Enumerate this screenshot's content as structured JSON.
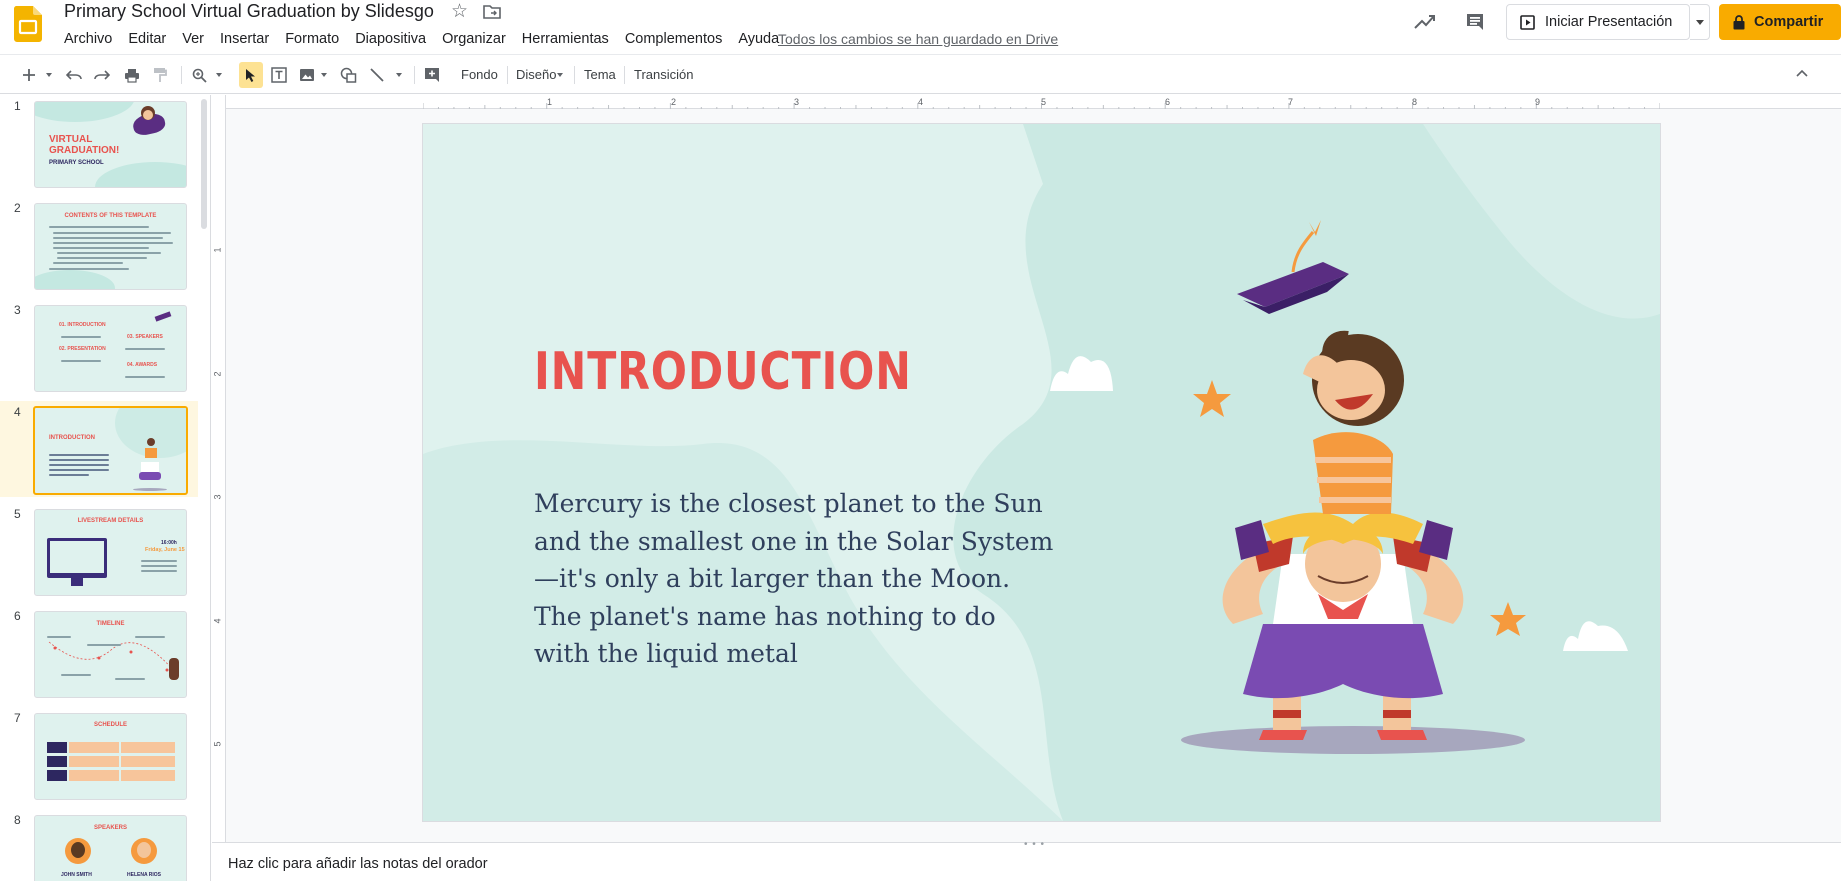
{
  "app": {
    "title": "Primary School Virtual Graduation by Slidesgo",
    "saved_status": "Todos los cambios se han guardado en Drive",
    "accent_color": "#f9ab00"
  },
  "menu": [
    "Archivo",
    "Editar",
    "Ver",
    "Insertar",
    "Formato",
    "Diapositiva",
    "Organizar",
    "Herramientas",
    "Complementos",
    "Ayuda"
  ],
  "header": {
    "present_label": "Iniciar Presentación",
    "share_label": "Compartir"
  },
  "toolbar": {
    "background_label": "Fondo",
    "layout_label": "Diseño",
    "theme_label": "Tema",
    "transition_label": "Transición"
  },
  "rulers": {
    "horizontal": [
      "1",
      "2",
      "3",
      "4",
      "5",
      "6",
      "7",
      "8",
      "9"
    ],
    "vertical": [
      "1",
      "2",
      "3",
      "4",
      "5"
    ]
  },
  "filmstrip": {
    "active_index": 4,
    "slides": [
      {
        "number": "1",
        "title": "VIRTUAL GRADUATION!",
        "subtitle": "PRIMARY SCHOOL"
      },
      {
        "number": "2",
        "title": "CONTENTS OF THIS TEMPLATE"
      },
      {
        "number": "3",
        "items": [
          "01. INTRODUCTION",
          "02. PRESENTATION",
          "03. SPEAKERS",
          "04. AWARDS"
        ]
      },
      {
        "number": "4",
        "title": "INTRODUCTION"
      },
      {
        "number": "5",
        "title": "LIVESTREAM DETAILS",
        "time": "16:00h",
        "date": "Friday, June 15"
      },
      {
        "number": "6",
        "title": "TIMELINE"
      },
      {
        "number": "7",
        "title": "SCHEDULE"
      },
      {
        "number": "8",
        "title": "SPEAKERS",
        "names": [
          "JOHN SMITH",
          "HELENA RIOS"
        ]
      }
    ]
  },
  "slide": {
    "title": "INTRODUCTION",
    "body": "Mercury is the closest planet to the Sun and the smallest one in the Solar System—it's only a bit larger than the Moon. The planet's name has nothing to do with the liquid metal",
    "title_color": "#e8534e",
    "background_color": "#dff2ee"
  },
  "notes": {
    "placeholder": "Haz clic para añadir las notas del orador"
  }
}
